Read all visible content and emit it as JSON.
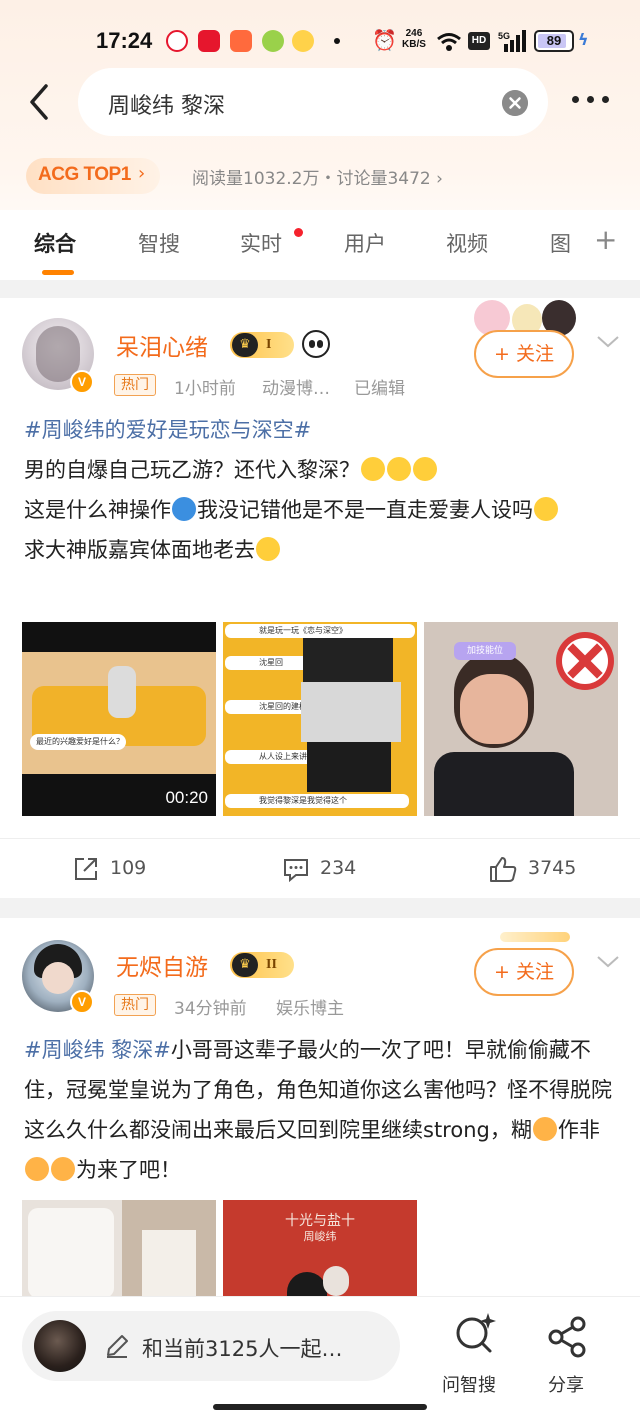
{
  "status_bar": {
    "time": "17:24",
    "net_speed": "246",
    "net_unit": "KB/S",
    "hd": "HD",
    "battery": "89",
    "battery_level": 0.89,
    "icons": [
      "weibo-app-icon",
      "taobao-app-icon",
      "app-icon",
      "app-icon",
      "app-icon",
      "dot",
      "alarm-icon",
      "wifi-icon",
      "signal-icon",
      "charging-icon"
    ]
  },
  "search": {
    "query": "周峻纬 黎深"
  },
  "topic": {
    "badge": "ACG TOP1",
    "stats": "阅读量1032.2万・讨论量3472"
  },
  "tabs": [
    {
      "label": "综合",
      "active": true
    },
    {
      "label": "智搜"
    },
    {
      "label": "实时"
    },
    {
      "label": "用户"
    },
    {
      "label": "视频"
    },
    {
      "label": "图"
    }
  ],
  "posts": [
    {
      "username": "呆泪心绪",
      "level": "I",
      "hot": "热门",
      "time": "1小时前",
      "source": "动漫博…",
      "edited": "已编辑",
      "follow": "+ 关注",
      "hashtag": "#周峻纬的爱好是玩恋与深空#",
      "lines": [
        "男的自爆自己玩乙游？还代入黎深？",
        "这是什么神操作",
        "我没记错他是不是一直走爱妻人设吗",
        "求大神版嘉宾体面地老去"
      ],
      "video_duration": "00:20",
      "image_captions": [
        "最近的兴趣爱好是什么？",
        "就是玩一玩《恋与深空》",
        "沈星回",
        "沈星回的建模更好看",
        "从人设上来讲",
        "我觉得黎深是我觉得这个",
        "加技能位"
      ],
      "shares": "109",
      "comments": "234",
      "likes": "3745"
    },
    {
      "username": "无烬自游",
      "level": "II",
      "hot": "热门",
      "time": "34分钟前",
      "source": "娱乐博主",
      "follow": "+ 关注",
      "hashtag": "#周峻纬 黎深#",
      "text1": "小哥哥这辈子最火的一次了吧！早就偷偷藏不住，冠冕堂皇说为了角色，角色知道你这么害他吗？怪不得脱院这么久什么都没闹出来最后又回到院里继续strong，糊",
      "text2": "作非",
      "text3": "为来了吧！",
      "poster_title": "十光与盐十",
      "poster_name": "周峻纬"
    }
  ],
  "bottom_bar": {
    "comment_placeholder": "和当前3125人一起…",
    "ask_label": "问智搜",
    "share_label": "分享"
  },
  "colors": {
    "accent": "#ff8200",
    "username": "#f36b1c",
    "hashtag": "#4c6fa6"
  }
}
